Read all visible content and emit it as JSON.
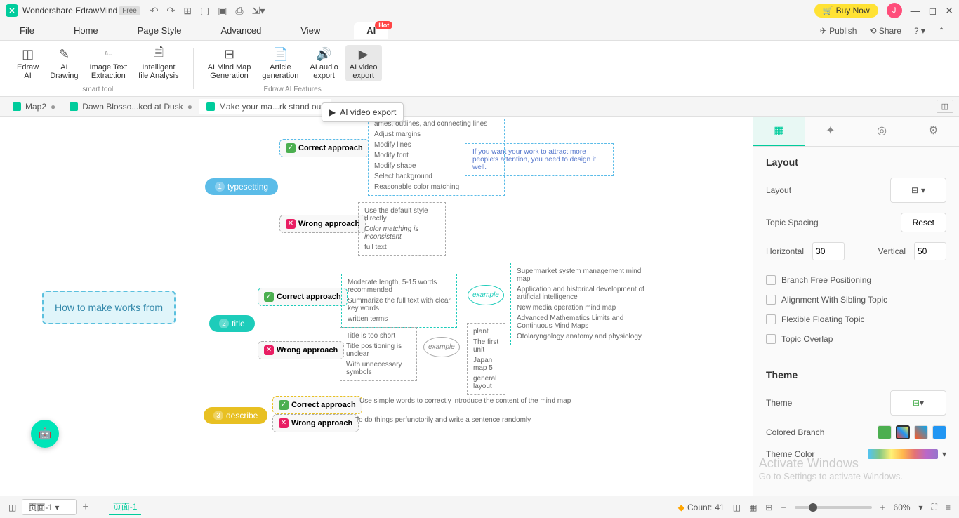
{
  "app": {
    "title": "Wondershare EdrawMind",
    "badge": "Free"
  },
  "titlebar": {
    "buy": "Buy Now",
    "user_initial": "J"
  },
  "menu": {
    "file": "File",
    "home": "Home",
    "page_style": "Page Style",
    "advanced": "Advanced",
    "view": "View",
    "ai": "AI",
    "hot": "Hot",
    "publish": "Publish",
    "share": "Share"
  },
  "ribbon": {
    "edraw_ai": "Edraw\nAI",
    "ai_drawing": "AI\nDrawing",
    "image_text": "Image Text\nExtraction",
    "file_analysis": "Intelligent\nfile Analysis",
    "mind_map": "AI Mind Map\nGeneration",
    "article": "Article\ngeneration",
    "audio": "AI audio\nexport",
    "video": "AI video\nexport",
    "group1": "smart tool",
    "group2": "Edraw AI Features"
  },
  "tabs": {
    "t1": "Map2",
    "t2": "Dawn Blosso...ked at Dusk",
    "t3": "Make your ma...rk stand out"
  },
  "tooltip": {
    "text": "AI video export"
  },
  "mindmap": {
    "root": "How to make works from",
    "sub1": "typesetting",
    "sub2": "title",
    "sub3": "describe",
    "correct": "Correct approach",
    "wrong": "Wrong approach",
    "d1a": "ames, outlines, and connecting lines",
    "d1b": "Adjust margins",
    "d1c": "Modify lines",
    "d1d": "Modify font",
    "d1e": "Modify shape",
    "d1f": "Select background",
    "d1g": "Reasonable color matching",
    "d2a": "Use the default style directly",
    "d2b": "Color matching is inconsistent",
    "d2c": "full text",
    "d3a": "Moderate length, 5-15 words recommended",
    "d3b": "Summarize the full text with clear key words",
    "d3c": "written terms",
    "d4a": "Title is too short",
    "d4b": "Title positioning is unclear",
    "d4c": "With unnecessary symbols",
    "d5a": "Supermarket system management mind map",
    "d5b": "Application and historical development of artificial intelligence",
    "d5c": "New media operation mind map",
    "d5d": "Advanced Mathematics Limits and Continuous Mind Maps",
    "d5e": "Otolaryngology anatomy and physiology",
    "d6a": "plant",
    "d6b": "The first unit",
    "d6c": "Japan map 5",
    "d6d": "general layout",
    "d7": "Use simple words to correctly introduce the content of the mind map",
    "d8": "To do things perfunctorily and write a sentence randomly",
    "example": "example",
    "callout": "If you want your work to attract more people's attention, you need to design it well."
  },
  "panel": {
    "layout": "Layout",
    "layout_label": "Layout",
    "topic_spacing": "Topic Spacing",
    "reset": "Reset",
    "horizontal": "Horizontal",
    "h_val": "30",
    "vertical": "Vertical",
    "v_val": "50",
    "cb1": "Branch Free Positioning",
    "cb2": "Alignment With Sibling Topic",
    "cb3": "Flexible Floating Topic",
    "cb4": "Topic Overlap",
    "theme": "Theme",
    "theme_label": "Theme",
    "colored_branch": "Colored Branch",
    "theme_color": "Theme Color"
  },
  "watermark": {
    "l1": "Activate Windows",
    "l2": "Go to Settings to activate Windows."
  },
  "bottom": {
    "page_dd": "页面-1",
    "page_tab": "页面-1",
    "count_label": "Count:",
    "count_val": "41",
    "zoom": "60%"
  }
}
